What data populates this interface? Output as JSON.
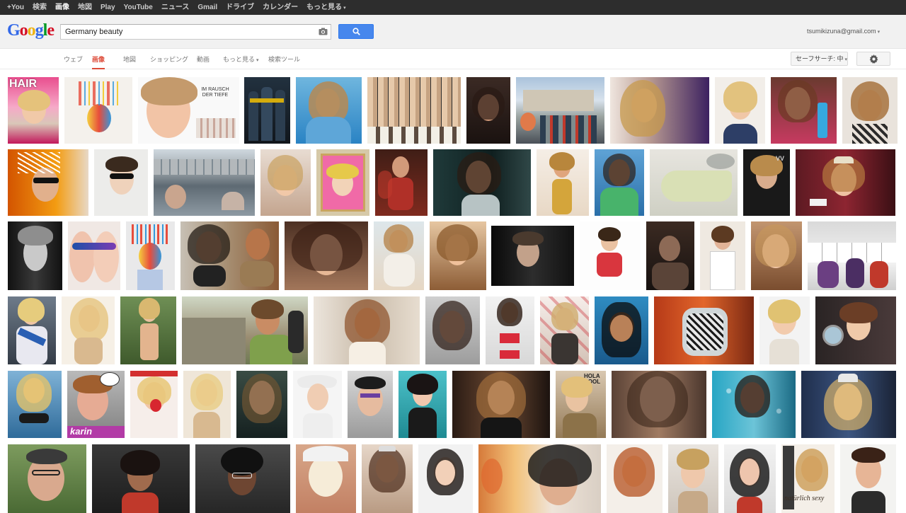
{
  "topbar": {
    "items": [
      {
        "label": "+You"
      },
      {
        "label": "検索"
      },
      {
        "label": "画像",
        "active": true
      },
      {
        "label": "地図"
      },
      {
        "label": "Play"
      },
      {
        "label": "YouTube"
      },
      {
        "label": "ニュース"
      },
      {
        "label": "Gmail"
      },
      {
        "label": "ドライブ"
      },
      {
        "label": "カレンダー"
      },
      {
        "label": "もっと見る",
        "dropdown": true
      }
    ]
  },
  "header": {
    "logo": "Google",
    "search_value": "Germany beauty",
    "account": "tsumikizuna@gmail.com"
  },
  "tabs": {
    "items": [
      {
        "label": "ウェブ"
      },
      {
        "label": "画像",
        "active": true
      },
      {
        "label": "地図"
      },
      {
        "label": "ショッピング"
      },
      {
        "label": "動画"
      },
      {
        "label": "もっと見る",
        "dropdown": true
      },
      {
        "label": "検索ツール"
      }
    ],
    "safesearch": "セーフサーチ: 中"
  },
  "images": {
    "hair_cover_text": "HAIR",
    "rausch_text": "IM RAUSCH DER TIEFE",
    "karin_text": "karin",
    "natural_text": "natürlich sexy",
    "hold_text": "HOLA COOL"
  },
  "colors": {
    "topbar": "#2d2d2d",
    "search_button": "#4787ed",
    "active_tab": "#dd4b39"
  }
}
